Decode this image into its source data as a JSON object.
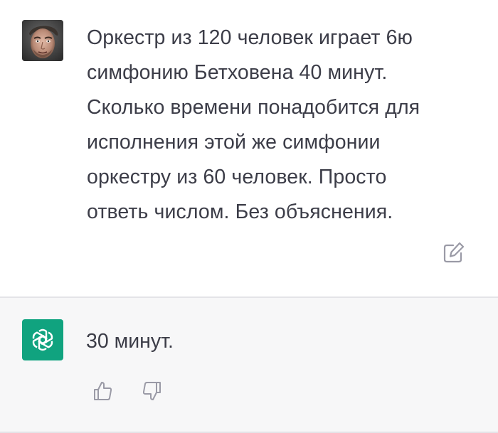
{
  "user_message": {
    "text": "Оркестр из 120 человек играет 6ю\nсимфонию Бетховена 40 минут.\nСколько времени понадобится для\nисполнения этой же симфонии\nоркестру из 60 человек. Просто\nответь числом. Без объяснения.",
    "avatar_icon": "user-photo-avatar",
    "edit_icon": "edit-icon"
  },
  "assistant_message": {
    "text": "30 минут.",
    "avatar_icon": "openai-logo-icon",
    "brand_color": "#10a37f",
    "feedback": {
      "like_icon": "thumbs-up-icon",
      "dislike_icon": "thumbs-down-icon"
    }
  },
  "colors": {
    "user_bg": "#ffffff",
    "assistant_bg": "#f7f7f8",
    "text": "#3c3d48",
    "icon": "#9a9aa6"
  }
}
